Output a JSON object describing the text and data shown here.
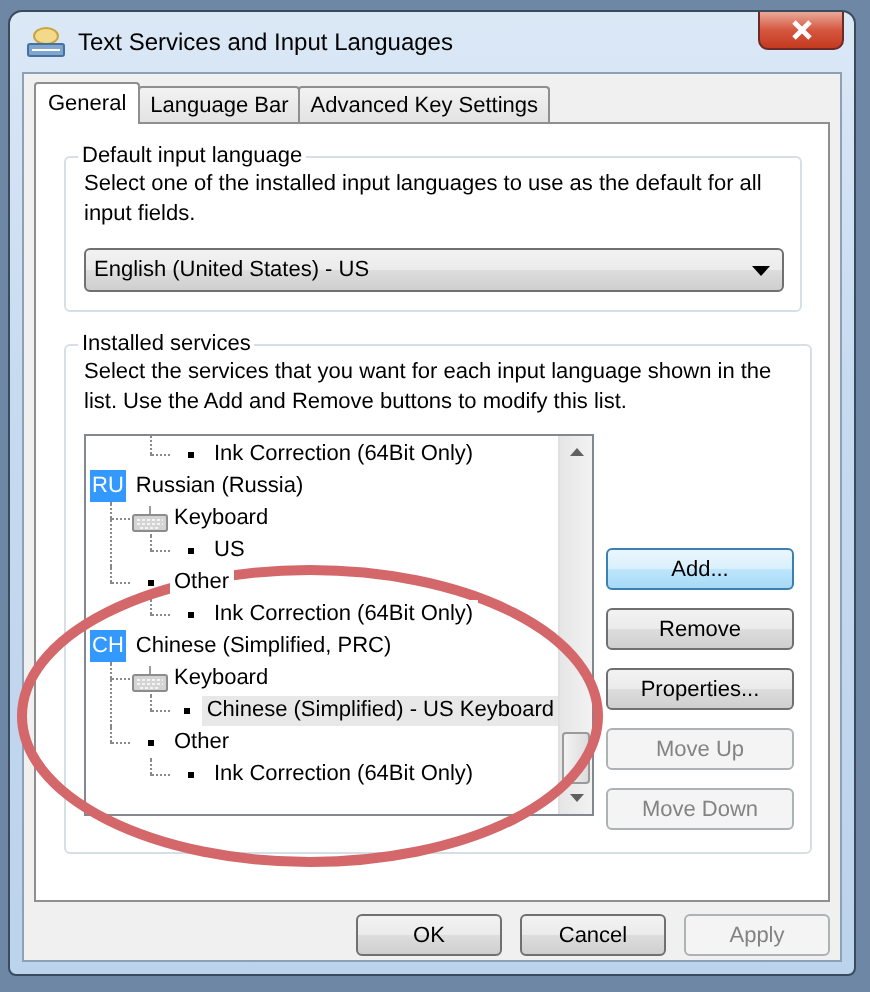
{
  "window": {
    "title": "Text Services and Input Languages"
  },
  "tabs": [
    {
      "label": "General",
      "selected": true
    },
    {
      "label": "Language Bar",
      "selected": false
    },
    {
      "label": "Advanced Key Settings",
      "selected": false
    }
  ],
  "default_input_language": {
    "heading": "Default input language",
    "description": "Select one of the installed input languages to use as the default for all input fields.",
    "value": "English (United States) - US"
  },
  "installed_services": {
    "heading": "Installed services",
    "description": "Select the services that you want for each input language shown in the list. Use the Add and Remove buttons to modify this list.",
    "tree": [
      {
        "kind": "language",
        "children": [
          {
            "kind": "other",
            "children": [
              {
                "kind": "service",
                "label": "Ink Correction (64Bit Only)",
                "selected": false
              }
            ]
          }
        ]
      },
      {
        "kind": "language",
        "code": "RU",
        "label": "Russian (Russia)",
        "selected": false,
        "children": [
          {
            "kind": "keyboard",
            "label": "Keyboard",
            "selected": false,
            "children": [
              {
                "kind": "service",
                "label": "US",
                "selected": false
              }
            ]
          },
          {
            "kind": "other",
            "label": "Other",
            "selected": false,
            "children": [
              {
                "kind": "service",
                "label": "Ink Correction (64Bit Only)",
                "selected": false
              }
            ]
          }
        ]
      },
      {
        "kind": "language",
        "code": "CH",
        "label": "Chinese (Simplified, PRC)",
        "selected": false,
        "children": [
          {
            "kind": "keyboard",
            "label": "Keyboard",
            "selected": false,
            "children": [
              {
                "kind": "service",
                "label": "Chinese (Simplified) - US Keyboard",
                "selected": true
              }
            ]
          },
          {
            "kind": "other",
            "label": "Other",
            "selected": false,
            "children": [
              {
                "kind": "service",
                "label": "Ink Correction (64Bit Only)",
                "selected": false
              }
            ]
          }
        ]
      }
    ],
    "buttons": [
      {
        "label": "Add...",
        "default": true,
        "disabled": false
      },
      {
        "label": "Remove",
        "default": false,
        "disabled": false
      },
      {
        "label": "Properties...",
        "default": false,
        "disabled": false
      },
      {
        "label": "Move Up",
        "default": false,
        "disabled": true
      },
      {
        "label": "Move Down",
        "default": false,
        "disabled": true
      }
    ]
  },
  "dialog_buttons": [
    {
      "label": "OK",
      "disabled": false
    },
    {
      "label": "Cancel",
      "disabled": false
    },
    {
      "label": "Apply",
      "disabled": true
    }
  ]
}
